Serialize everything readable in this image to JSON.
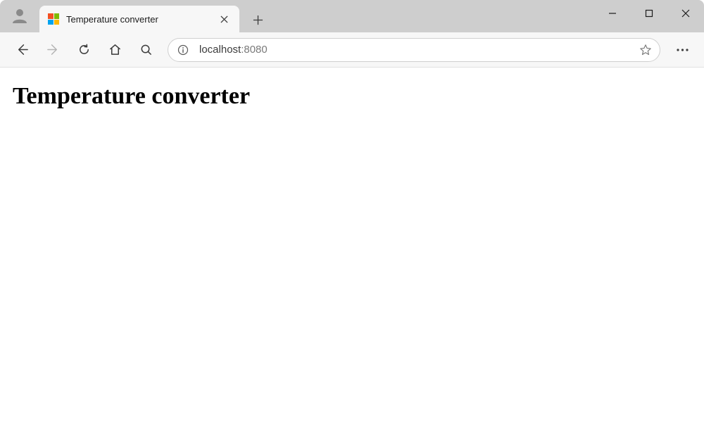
{
  "tab": {
    "title": "Temperature converter"
  },
  "address": {
    "host": "localhost",
    "port_separator": ":",
    "port": "8080"
  },
  "page": {
    "heading": "Temperature converter"
  }
}
